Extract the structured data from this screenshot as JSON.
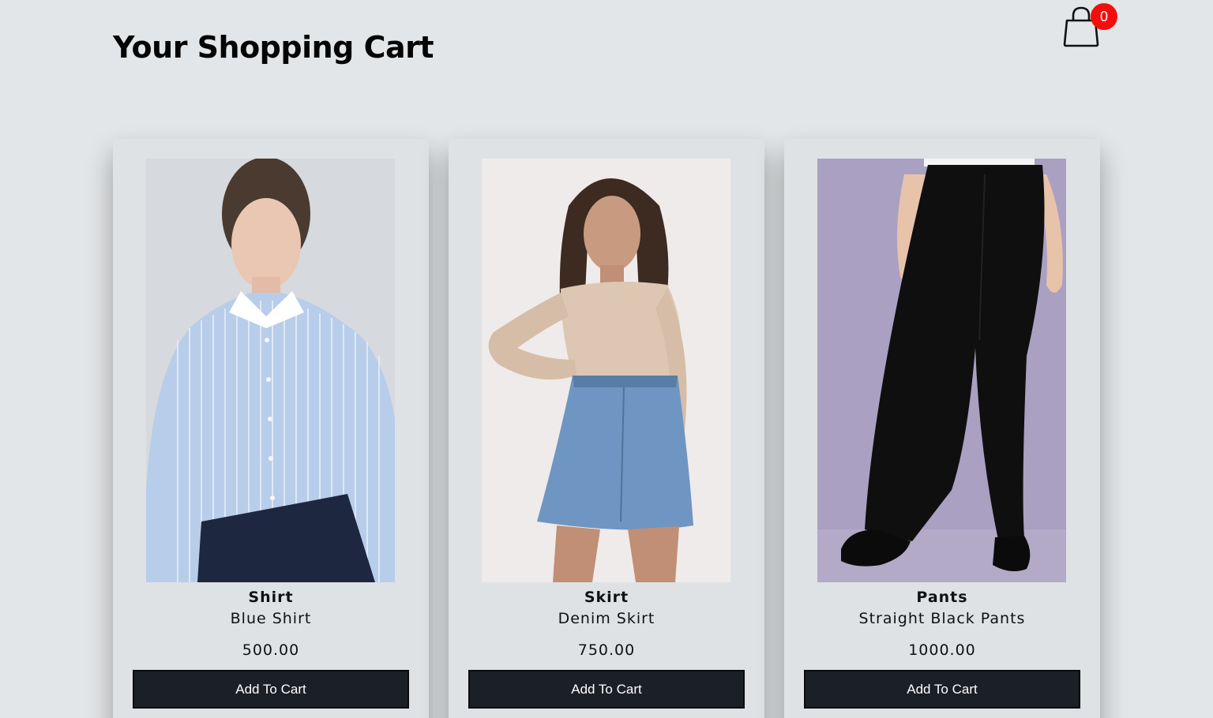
{
  "header": {
    "title": "Your Shopping Cart",
    "cart_icon": "shopping-bag-icon",
    "cart_count": "0",
    "badge_color": "#f50d0d"
  },
  "products": [
    {
      "category": "Shirt",
      "name": "Blue Shirt",
      "price": "500.00",
      "button_label": "Add To Cart",
      "image": "woman-in-blue-striped-shirt-photo"
    },
    {
      "category": "Skirt",
      "name": "Denim Skirt",
      "price": "750.00",
      "button_label": "Add To Cart",
      "image": "woman-in-denim-skirt-photo"
    },
    {
      "category": "Pants",
      "name": "Straight Black Pants",
      "price": "1000.00",
      "button_label": "Add To Cart",
      "image": "black-pants-photo"
    }
  ],
  "colors": {
    "background": "#e3e6e8",
    "card": "#dfe2e5",
    "button": "#1b1f26"
  }
}
